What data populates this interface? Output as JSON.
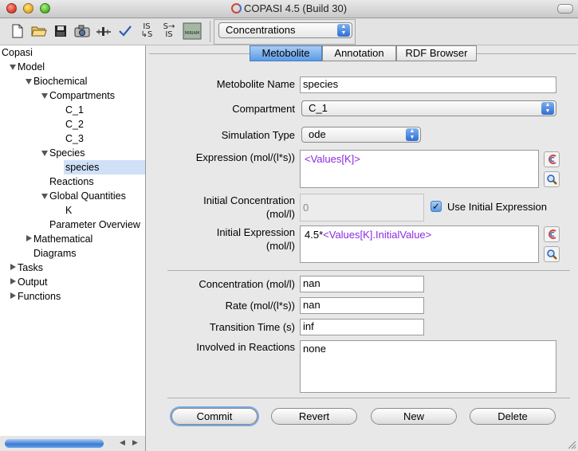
{
  "window": {
    "title": "COPASI 4.5 (Build 30)"
  },
  "toolbar": {
    "buttons": [
      {
        "name": "new",
        "icon": "new-document-icon"
      },
      {
        "name": "open",
        "icon": "open-folder-icon"
      },
      {
        "name": "save",
        "icon": "save-disk-icon"
      },
      {
        "name": "capture",
        "icon": "camera-icon"
      },
      {
        "name": "slider",
        "icon": "slider-icon"
      },
      {
        "name": "check",
        "icon": "checkmark-icon"
      },
      {
        "name": "import-sbml",
        "label": "IS→S"
      },
      {
        "name": "export-sbml",
        "label": "S→IS"
      },
      {
        "name": "miriam",
        "label": "MIRIAM"
      }
    ],
    "view_select": "Concentrations"
  },
  "tree": {
    "root": "Copasi",
    "model": "Model",
    "biochemical": "Biochemical",
    "compartments": "Compartments",
    "compartment_items": [
      "C_1",
      "C_2",
      "C_3"
    ],
    "species": "Species",
    "species_item": "species",
    "reactions": "Reactions",
    "global_quantities": "Global Quantities",
    "global_item": "K",
    "parameter_overview": "Parameter Overview",
    "mathematical": "Mathematical",
    "diagrams": "Diagrams",
    "tasks": "Tasks",
    "output": "Output",
    "functions": "Functions"
  },
  "tabs": [
    "Metobolite",
    "Annotation",
    "RDF Browser"
  ],
  "form": {
    "name_label": "Metobolite Name",
    "name_value": "species",
    "compartment_label": "Compartment",
    "compartment_value": "C_1",
    "simtype_label": "Simulation Type",
    "simtype_value": "ode",
    "expression_label": "Expression (mol/(l*s))",
    "expression_value": "<Values[K]>",
    "initconc_label_1": "Initial Concentration",
    "initconc_label_2": "(mol/l)",
    "initconc_value": "0",
    "use_initial_label": "Use Initial Expression",
    "initexpr_label_1": "Initial Expression",
    "initexpr_label_2": "(mol/l)",
    "initexpr_prefix": "4.5*",
    "initexpr_ref": "<Values[K].InitialValue>",
    "conc_label": "Concentration (mol/l)",
    "conc_value": "nan",
    "rate_label": "Rate (mol/(l*s))",
    "rate_value": "nan",
    "transition_label": "Transition Time (s)",
    "transition_value": "inf",
    "involved_label": "Involved in Reactions",
    "involved_value": "none"
  },
  "buttons": {
    "commit": "Commit",
    "revert": "Revert",
    "new": "New",
    "delete": "Delete"
  }
}
